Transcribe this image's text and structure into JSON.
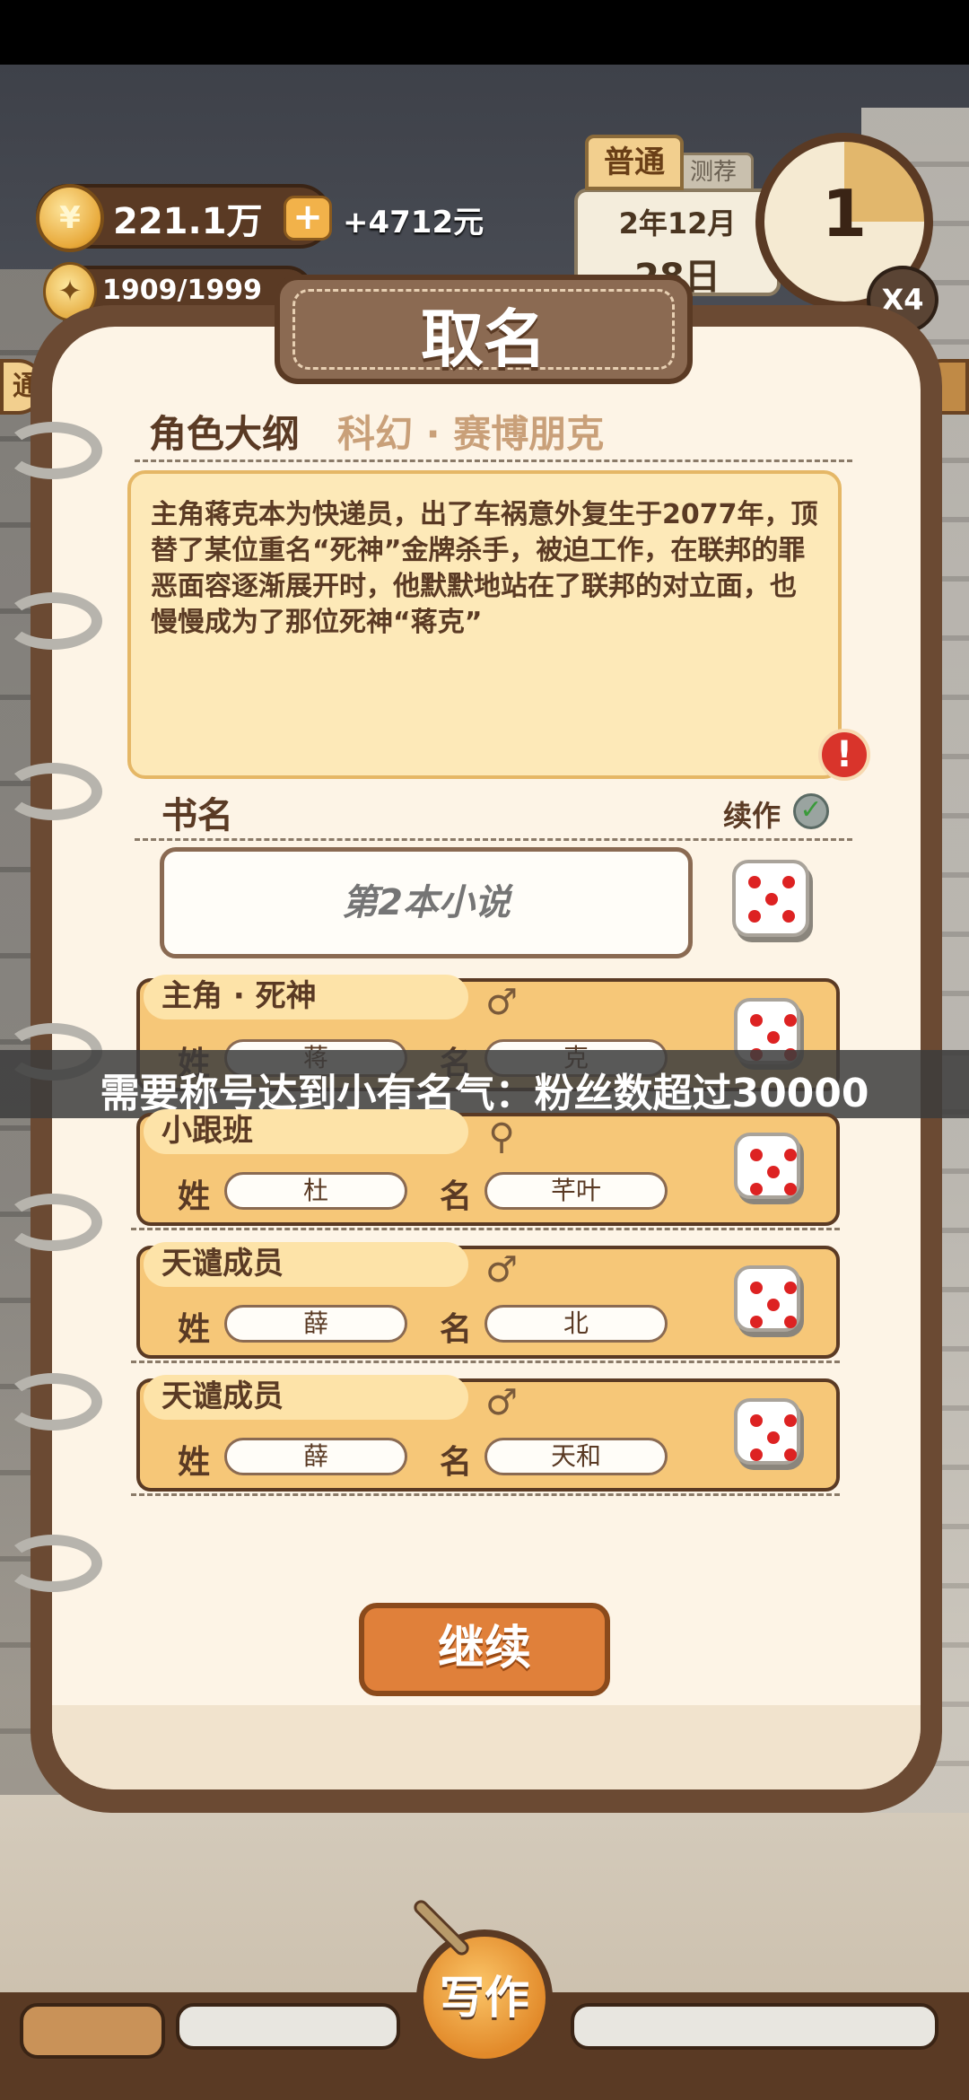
{
  "hud": {
    "coins": "221.1万",
    "income": "+4712元",
    "energy": "1909/1999",
    "coin_symbol": "¥",
    "plus": "+"
  },
  "calendar": {
    "tab": "普通",
    "tab2": "测荐",
    "month": "2年12月",
    "day": "28日"
  },
  "clock": {
    "number": "1",
    "speed": "X4"
  },
  "side": {
    "left_tab": "通"
  },
  "dialog": {
    "title": "取名",
    "outline_label": "角色大纲",
    "genre": "科幻 · 赛博朋克",
    "synopsis": "主角蒋克本为快递员，出了车祸意外复生于2077年，顶替了某位重名“死神”金牌杀手，被迫工作，在联邦的罪恶面容逐渐展开时，他默默地站在了联邦的对立面，也慢慢成为了那位死神“蒋克”",
    "alert": "!",
    "book_name_label": "书名",
    "sequel_label": "续作",
    "book_name_placeholder": "第2本小说",
    "surname_label": "姓",
    "givenname_label": "名",
    "continue": "继续"
  },
  "characters": [
    {
      "role": "主角 · 死神",
      "gender": "♂",
      "surname": "蒋",
      "given": "克"
    },
    {
      "role": "小跟班",
      "gender": "⚲",
      "surname": "杜",
      "given": "芊叶"
    },
    {
      "role": "天谴成员",
      "gender": "♂",
      "surname": "薛",
      "given": "北"
    },
    {
      "role": "天谴成员",
      "gender": "♂",
      "surname": "薛",
      "given": "天和"
    }
  ],
  "toast": "需要称号达到小有名气：粉丝数超过30000",
  "bottom": {
    "write": "写作"
  },
  "colors": {
    "accent": "#e0803a",
    "card": "#f6c778",
    "frame": "#6b4a33",
    "page": "#fdf4e6"
  }
}
